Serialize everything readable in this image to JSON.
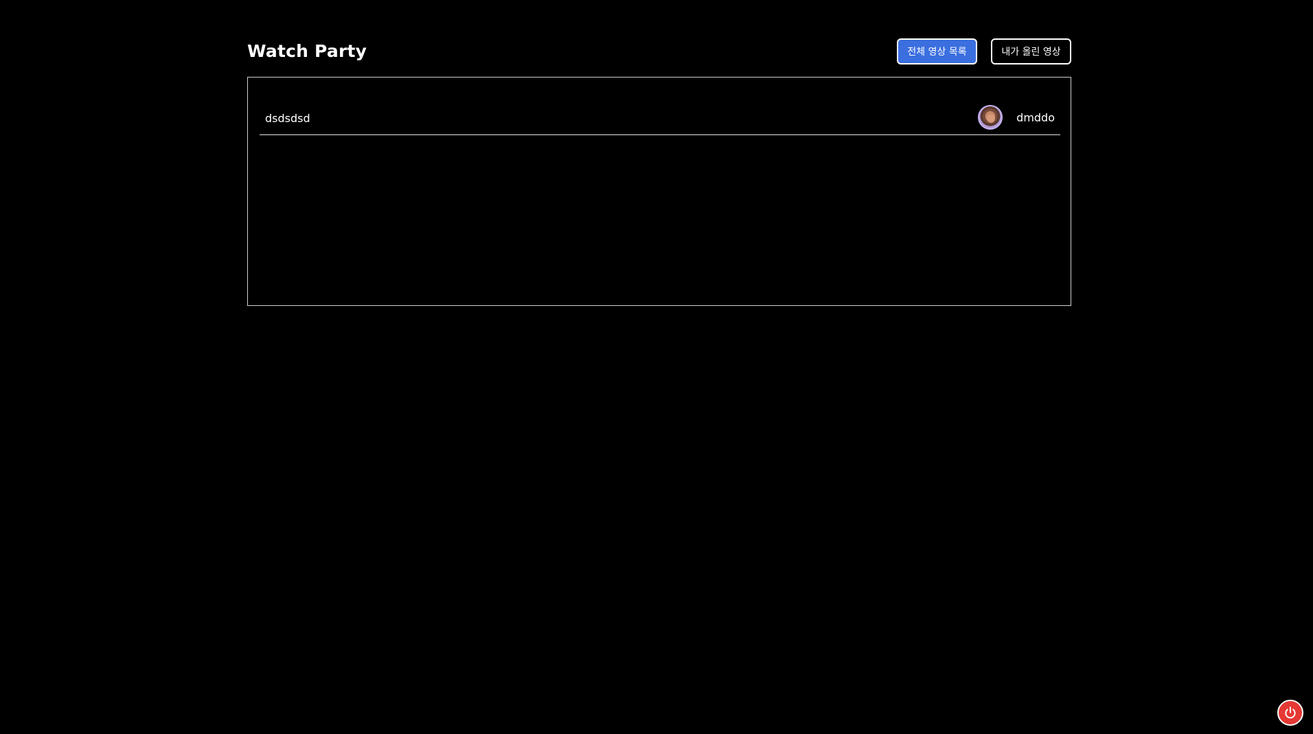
{
  "header": {
    "title": "Watch Party",
    "buttons": {
      "all_videos": "전체 영상 목록",
      "my_videos": "내가 올린 영상"
    }
  },
  "videos": [
    {
      "title": "dsdsdsd",
      "uploader": "dmddo"
    }
  ],
  "icons": {
    "power": "power-icon",
    "avatar": "avatar"
  },
  "colors": {
    "background": "#000000",
    "accent": "#3b6fe0",
    "power": "#e53935"
  }
}
